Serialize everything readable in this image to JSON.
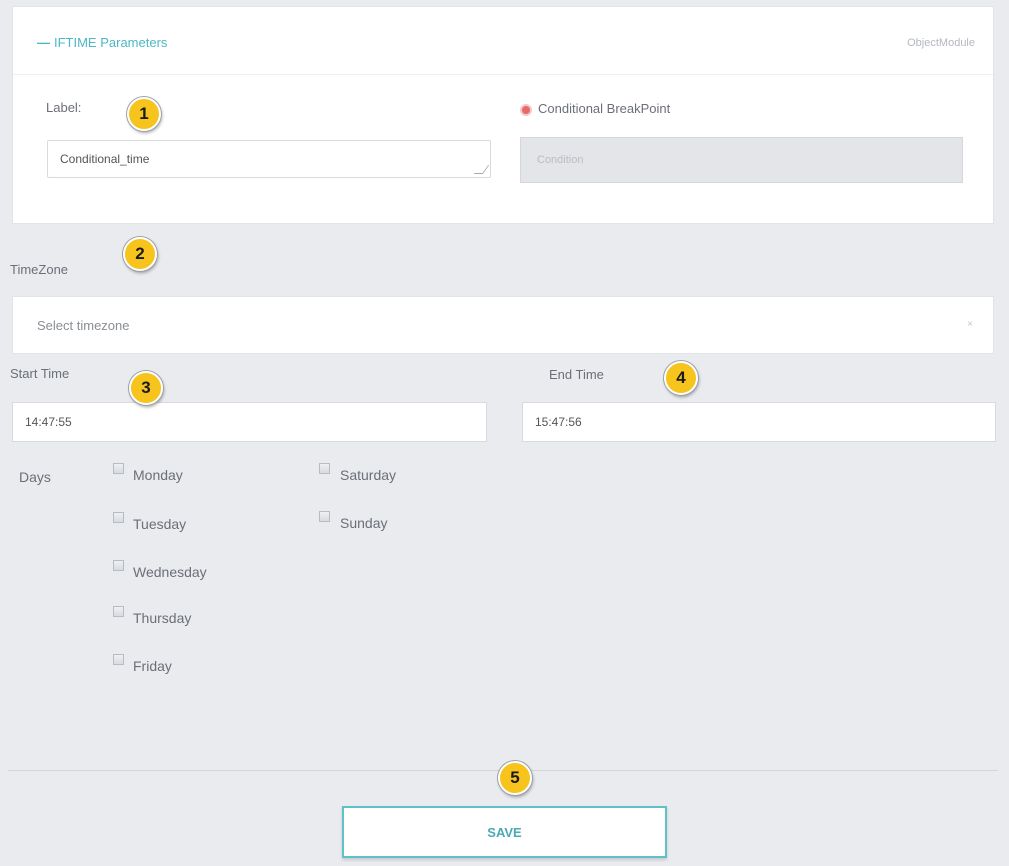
{
  "panel": {
    "title": "IFTIME Parameters",
    "collapse_symbol": "—",
    "module_link": "ObjectModule"
  },
  "label_field": {
    "label": "Label:",
    "value": "Conditional_time"
  },
  "breakpoint": {
    "label": "Conditional BreakPoint",
    "placeholder": "Condition"
  },
  "timezone": {
    "label": "TimeZone",
    "placeholder": "Select timezone",
    "clear_symbol": "×"
  },
  "start_time": {
    "label": "Start Time",
    "value": "14:47:55"
  },
  "end_time": {
    "label": "End Time",
    "value": "15:47:56"
  },
  "days": {
    "label": "Days",
    "items": [
      "Monday",
      "Tuesday",
      "Wednesday",
      "Thursday",
      "Friday",
      "Saturday",
      "Sunday"
    ]
  },
  "save_label": "SAVE",
  "badges": [
    "1",
    "2",
    "3",
    "4",
    "5"
  ],
  "colors": {
    "accent": "#4bb8c4",
    "badge": "#f7c31d",
    "breakpoint_dot": "#e56a6a",
    "background": "#e9ebef"
  }
}
